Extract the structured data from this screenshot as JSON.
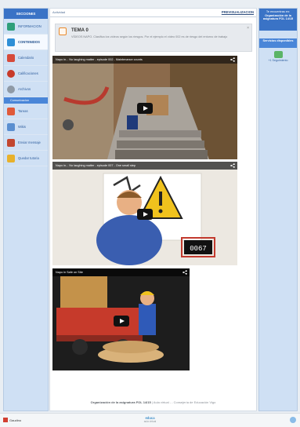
{
  "sidebar": {
    "header": "SECCIONES",
    "sub_header": "Comunicacion",
    "items": [
      {
        "label": "INFORMACION",
        "icon": "info-icon",
        "color": "#2f9f7a"
      },
      {
        "label": "CONTENIDOS",
        "icon": "book-icon",
        "color": "#2f8fd6",
        "active": true
      },
      {
        "label": "Calendario",
        "icon": "calendar-icon",
        "color": "#d64a3a"
      },
      {
        "label": "Calificaciones",
        "icon": "ribbon-icon",
        "color": "#c73a2a"
      },
      {
        "label": "Archivos",
        "icon": "folder-icon",
        "color": "#8f9aa6"
      }
    ],
    "items2": [
      {
        "label": "Tareas",
        "icon": "task-icon",
        "color": "#e05a3a"
      },
      {
        "label": "Wikis",
        "icon": "wiki-icon",
        "color": "#5b8fd0"
      },
      {
        "label": "Enviar mensaje",
        "icon": "message-icon",
        "color": "#c2462f"
      },
      {
        "label": "Quedar tutoria",
        "icon": "mail-icon",
        "color": "#e8b12b"
      }
    ]
  },
  "main": {
    "breadcrumb": "Actividad",
    "preview_label": "PREVISUALIZACION",
    "topic": {
      "title": "TEMA 0",
      "desc": "VÍDEOS NAPO. Clasifica los vídeos según los riesgos. Por el ejemplo el vídeo 002 es de riesgo del entorno de trabajo",
      "close": "×"
    },
    "videos": [
      {
        "title": "Napo in... No laughing matter - episode 002 - Maintenance counts"
      },
      {
        "title": "Napo in... No laughing matter - episode 007 - One small step"
      },
      {
        "title": "Napo in Safe on Site"
      }
    ],
    "footer_bold": "Organización de la asignatura FOL 14/15",
    "footer_rest": "| Aula virtual - - Consejería de Educación Vigo"
  },
  "right": {
    "head_line1": "Te encuentras en:",
    "head_line2": "Organización de la asignatura FOL 14/15",
    "sub_header": "Servicios disponibles",
    "item_label": "+1 Seguimiento"
  },
  "bottom": {
    "logo": "Gaudino",
    "center": "educa",
    "center_sub": "aula virtual"
  }
}
